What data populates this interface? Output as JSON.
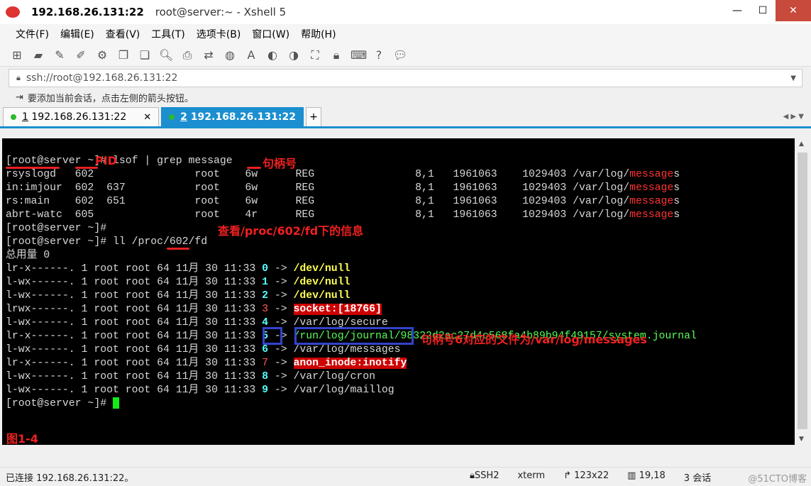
{
  "window": {
    "host": "192.168.26.131:22",
    "title": "root@server:~ - Xshell 5",
    "minimize": "—",
    "maximize": "☐",
    "close": "✕"
  },
  "menu": [
    "文件(F)",
    "编辑(E)",
    "查看(V)",
    "工具(T)",
    "选项卡(B)",
    "窗口(W)",
    "帮助(H)"
  ],
  "address": {
    "value": "ssh://root@192.168.26.131:22"
  },
  "hint": "要添加当前会话，点击左侧的箭头按钮。",
  "tabs": [
    {
      "num": "1",
      "label": "192.168.26.131:22",
      "active": false
    },
    {
      "num": "2",
      "label": "192.168.26.131:22",
      "active": true
    }
  ],
  "terminal": {
    "cmd1": "[root@server ~]# lsof | grep message",
    "lsof_rows": [
      {
        "pre": "rsyslogd   602                root    6w      REG                8,1   1961063    1029403 /var/log/",
        "hl": "message",
        "post": "s"
      },
      {
        "pre": "in:imjour  602  637           root    6w      REG                8,1   1961063    1029403 /var/log/",
        "hl": "message",
        "post": "s"
      },
      {
        "pre": "rs:main    602  651           root    6w      REG                8,1   1961063    1029403 /var/log/",
        "hl": "message",
        "post": "s"
      },
      {
        "pre": "abrt-watc  605                root    4r      REG                8,1   1961063    1029403 /var/log/",
        "hl": "message",
        "post": "s"
      }
    ],
    "prompt": "[root@server ~]#",
    "cmd2": "[root@server ~]# ll /proc/602/fd",
    "total": "总用量 0",
    "fd_rows": [
      {
        "perm": "lr-x------. 1 root root 64 11月 30 11:33 ",
        "fd": "0",
        "target": "/dev/null",
        "style": "y"
      },
      {
        "perm": "l-wx------. 1 root root 64 11月 30 11:33 ",
        "fd": "1",
        "target": "/dev/null",
        "style": "y"
      },
      {
        "perm": "l-wx------. 1 root root 64 11月 30 11:33 ",
        "fd": "2",
        "target": "/dev/null",
        "style": "y"
      },
      {
        "perm": "lrwx------. 1 root root 64 11月 30 11:33 ",
        "fd": "3",
        "target": "socket:[18766]",
        "style": "rb"
      },
      {
        "perm": "l-wx------. 1 root root 64 11月 30 11:33 ",
        "fd": "4",
        "target": "/var/log/secure",
        "style": ""
      },
      {
        "perm": "lr-x------. 1 root root 64 11月 30 11:33 ",
        "fd": "5",
        "target": "/run/log/journal/98322d2ac27d4c568fa4b89b94f49157/system.journal",
        "style": "g"
      },
      {
        "perm": "l-wx------. 1 root root 64 11月 30 11:33 ",
        "fd": "6",
        "target": "/var/log/messages",
        "style": ""
      },
      {
        "perm": "lr-x------. 1 root root 64 11月 30 11:33 ",
        "fd": "7",
        "target": "anon_inode:inotify",
        "style": "rb"
      },
      {
        "perm": "l-wx------. 1 root root 64 11月 30 11:33 ",
        "fd": "8",
        "target": "/var/log/cron",
        "style": ""
      },
      {
        "perm": "l-wx------. 1 root root 64 11月 30 11:33 ",
        "fd": "9",
        "target": "/var/log/maillog",
        "style": ""
      }
    ],
    "arrow": " -> ",
    "prompt_final": "[root@server ~]# "
  },
  "annotations": {
    "pid": "PID",
    "handle": "句柄号",
    "proc": "查看/proc/602/fd下的信息",
    "fd6": "句柄号6对应的文件为/var/log/messages",
    "figure": "图1-4"
  },
  "status": {
    "connected": "已连接 192.168.26.131:22。",
    "protocol": "SSH2",
    "term": "xterm",
    "size": "123x22",
    "cursor": "19,18",
    "sessions": "3 会话",
    "watermark": "@51CTO博客"
  }
}
